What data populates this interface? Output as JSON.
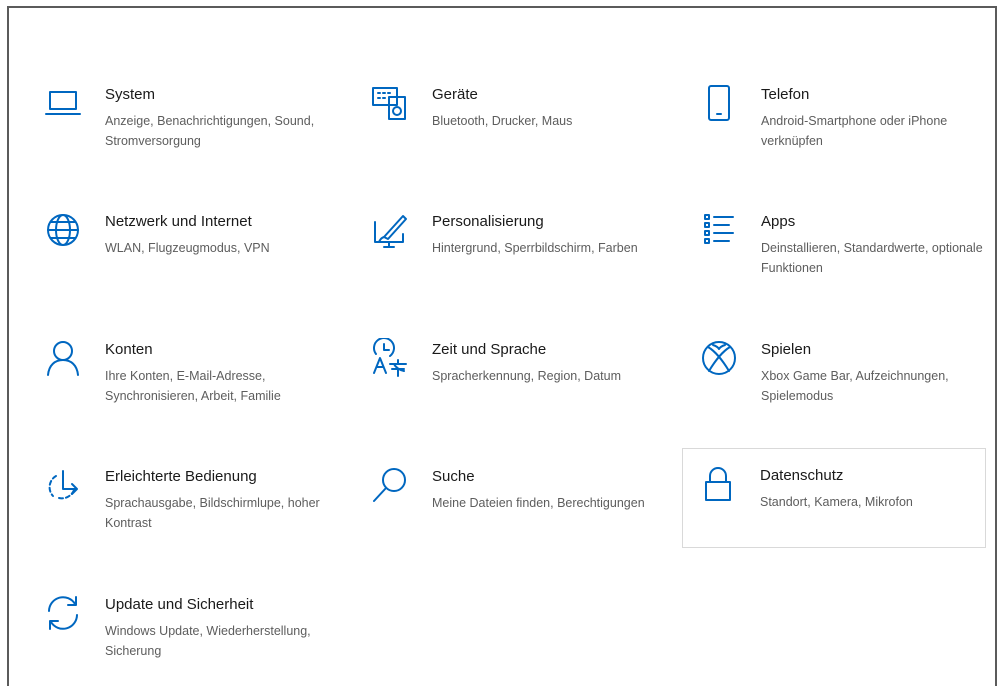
{
  "accent_color": "#0067c0",
  "tiles": [
    {
      "name": "system",
      "icon": "laptop-icon",
      "title": "System",
      "desc": "Anzeige, Benachrichtigungen, Sound, Stromversorgung"
    },
    {
      "name": "geraete",
      "icon": "keyboard-speaker-icon",
      "title": "Geräte",
      "desc": "Bluetooth, Drucker, Maus"
    },
    {
      "name": "telefon",
      "icon": "phone-icon",
      "title": "Telefon",
      "desc": "Android-Smartphone oder iPhone verknüpfen"
    },
    {
      "name": "netzwerk",
      "icon": "globe-icon",
      "title": "Netzwerk und Internet",
      "desc": "WLAN, Flugzeugmodus, VPN"
    },
    {
      "name": "personalisierung",
      "icon": "brush-screen-icon",
      "title": "Personalisierung",
      "desc": "Hintergrund, Sperrbildschirm, Farben"
    },
    {
      "name": "apps",
      "icon": "apps-list-icon",
      "title": "Apps",
      "desc": "Deinstallieren, Standardwerte, optionale Funktionen"
    },
    {
      "name": "konten",
      "icon": "person-icon",
      "title": "Konten",
      "desc": "Ihre Konten, E-Mail-Adresse, Synchronisieren, Arbeit, Familie"
    },
    {
      "name": "zeit-sprache",
      "icon": "time-language-icon",
      "title": "Zeit und Sprache",
      "desc": "Spracherkennung, Region, Datum"
    },
    {
      "name": "spielen",
      "icon": "xbox-icon",
      "title": "Spielen",
      "desc": "Xbox Game Bar, Aufzeichnungen, Spielemodus"
    },
    {
      "name": "erleichterte-bedienung",
      "icon": "ease-of-access-icon",
      "title": "Erleichterte Bedienung",
      "desc": "Sprachausgabe, Bildschirmlupe, hoher Kontrast"
    },
    {
      "name": "suche",
      "icon": "search-icon",
      "title": "Suche",
      "desc": "Meine Dateien finden, Berechtigungen"
    },
    {
      "name": "datenschutz",
      "icon": "lock-icon",
      "title": "Datenschutz",
      "desc": "Standort, Kamera, Mikrofon"
    },
    {
      "name": "update-sicherheit",
      "icon": "sync-icon",
      "title": "Update und Sicherheit",
      "desc": "Windows Update, Wiederherstellung, Sicherung"
    }
  ]
}
